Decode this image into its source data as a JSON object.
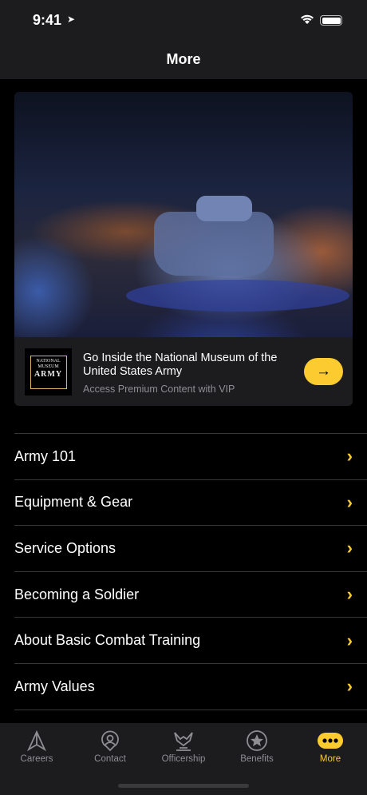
{
  "status": {
    "time": "9:41"
  },
  "nav": {
    "title": "More"
  },
  "promo": {
    "logo_text": "NATIONAL MUSEUM UNITED STATES ARMY",
    "title": "Go Inside the National Museum of the United States Army",
    "subtitle": "Access Premium Content with VIP"
  },
  "menu": [
    "Army 101",
    "Equipment & Gear",
    "Service Options",
    "Becoming a Soldier",
    "About Basic Combat Training",
    "Army Values"
  ],
  "tabs": [
    {
      "label": "Careers",
      "icon": "navigation-arrow-icon"
    },
    {
      "label": "Contact",
      "icon": "location-person-icon"
    },
    {
      "label": "Officership",
      "icon": "eagle-icon"
    },
    {
      "label": "Benefits",
      "icon": "star-circle-icon"
    },
    {
      "label": "More",
      "icon": "more-dots-icon",
      "active": true
    }
  ],
  "colors": {
    "accent": "#fccb2f",
    "bar": "#1c1c1e"
  }
}
